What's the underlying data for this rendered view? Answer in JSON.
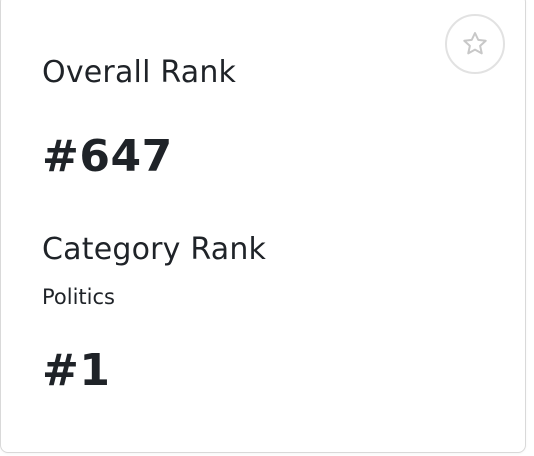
{
  "overall": {
    "label": "Overall Rank",
    "value": "#647"
  },
  "category": {
    "label": "Category Rank",
    "name": "Politics",
    "value": "#1"
  },
  "favorite": {
    "icon": "star-icon"
  },
  "colors": {
    "text": "#1f2328",
    "border": "#d9d9d9",
    "icon": "#c8c8c8"
  }
}
